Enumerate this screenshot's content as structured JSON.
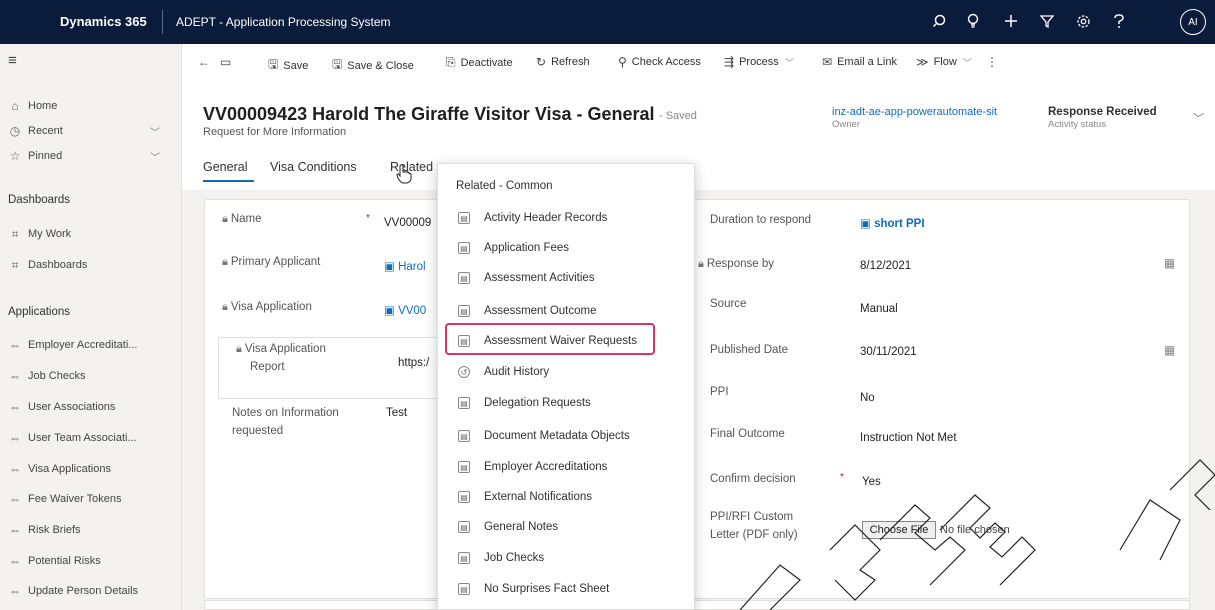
{
  "topbar": {
    "brand": "Dynamics 365",
    "app_name": "ADEPT - Application Processing System",
    "avatar": "AI",
    "icons": [
      "search-icon",
      "lightbulb-icon",
      "plus-icon",
      "filter-icon",
      "settings-icon",
      "help-icon"
    ]
  },
  "sidebar": {
    "nav": [
      {
        "label": "Home",
        "icon": "home-icon"
      },
      {
        "label": "Recent",
        "icon": "clock-icon"
      },
      {
        "label": "Pinned",
        "icon": "pin-icon"
      }
    ],
    "dashboards_heading": "Dashboards",
    "dashboards": [
      {
        "label": "My Work"
      },
      {
        "label": "Dashboards"
      }
    ],
    "applications_heading": "Applications",
    "applications": [
      {
        "label": "Employer Accreditati..."
      },
      {
        "label": "Job Checks"
      },
      {
        "label": "User Associations"
      },
      {
        "label": "User Team Associati..."
      },
      {
        "label": "Visa Applications"
      },
      {
        "label": "Fee Waiver Tokens"
      },
      {
        "label": "Risk Briefs"
      },
      {
        "label": "Potential Risks"
      },
      {
        "label": "Update Person Details"
      }
    ]
  },
  "commands": {
    "save": "Save",
    "save_close": "Save & Close",
    "deactivate": "Deactivate",
    "refresh": "Refresh",
    "check_access": "Check Access",
    "process": "Process",
    "email_link": "Email a Link",
    "flow": "Flow"
  },
  "record": {
    "title": "VV00009423 Harold The Giraffe Visitor Visa - General",
    "saved": "- Saved",
    "subtitle": "Request for More Information",
    "owner_value": "inz-adt-ae-app-powerautomate-sit",
    "owner_label": "Owner",
    "status_value": "Response Received",
    "status_label": "Activity status"
  },
  "tabs": [
    "General",
    "Visa Conditions",
    "Related"
  ],
  "form_left": {
    "name_label": "Name",
    "name_value": "VV00009",
    "primary_applicant_label": "Primary Applicant",
    "primary_applicant_value": "Harol",
    "visa_application_label": "Visa Application",
    "visa_application_value": "VV00",
    "visa_report_label_1": "Visa Application",
    "visa_report_label_2": "Report",
    "visa_report_value": "https:/",
    "notes_label_1": "Notes on Information",
    "notes_label_2": "requested",
    "notes_value": "Test"
  },
  "form_right": {
    "duration_label": "Duration to respond",
    "duration_value": "short PPI",
    "response_by_label": "Response by",
    "response_by_value": "8/12/2021",
    "source_label": "Source",
    "source_value": "Manual",
    "published_label": "Published Date",
    "published_value": "30/11/2021",
    "ppi_label": "PPI",
    "ppi_value": "No",
    "final_outcome_label": "Final Outcome",
    "final_outcome_value": "Instruction Not Met",
    "confirm_label": "Confirm decision",
    "confirm_value": "Yes",
    "custom_letter_label_1": "PPI/RFI Custom",
    "custom_letter_label_2": "Letter (PDF only)",
    "choose_file": "Choose File",
    "no_file": "No file chosen"
  },
  "related_menu": {
    "heading": "Related - Common",
    "items": [
      "Activity Header Records",
      "Application Fees",
      "Assessment Activities",
      "Assessment Outcome",
      "Assessment Waiver Requests",
      "Audit History",
      "Delegation Requests",
      "Document Metadata Objects",
      "Employer Accreditations",
      "External Notifications",
      "General Notes",
      "Job Checks",
      "No Surprises Fact Sheet"
    ],
    "highlighted": "Assessment Waiver Requests",
    "highlight_color": "#d7336a"
  },
  "colors": {
    "topbar": "#0b1b3b",
    "link": "#0f6cbd"
  }
}
